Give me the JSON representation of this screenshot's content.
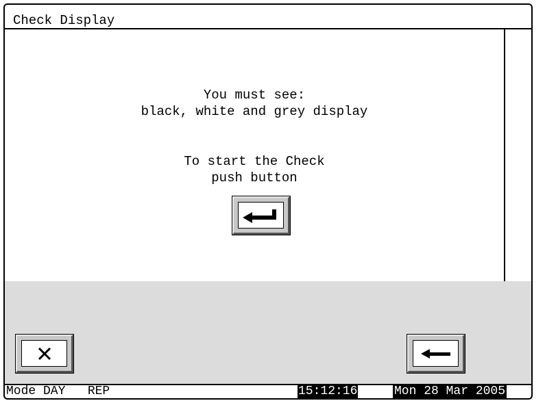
{
  "window": {
    "title": "Check Display"
  },
  "message": {
    "line1": "You must see:",
    "line2": "black, white and grey display",
    "line3": "To start the Check",
    "line4": "push button"
  },
  "buttons": {
    "enter_icon": "enter-arrow-icon",
    "cancel_icon": "close-icon",
    "back_icon": "back-arrow-icon"
  },
  "status": {
    "mode": "Mode DAY   REP",
    "time": "15:12:16",
    "date": "Mon 28 Mar 2005"
  }
}
